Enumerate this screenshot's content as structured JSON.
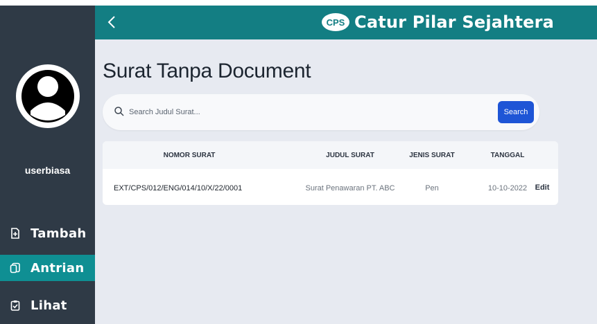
{
  "app": {
    "brand_name": "Catur Pilar Sejahtera",
    "brand_logo_text": "CPS"
  },
  "sidebar": {
    "username": "userbiasa",
    "items": [
      {
        "label": "Tambah",
        "icon": "file-plus-icon",
        "active": false
      },
      {
        "label": "Antrian",
        "icon": "copy-icon",
        "active": true
      },
      {
        "label": "Lihat",
        "icon": "clipboard-check-icon",
        "active": false
      }
    ]
  },
  "page": {
    "title": "Surat Tanpa Document"
  },
  "search": {
    "placeholder": "Search Judul Surat...",
    "value": "",
    "button_label": "Search"
  },
  "table": {
    "columns": [
      "NOMOR SURAT",
      "JUDUL SURAT",
      "JENIS SURAT",
      "TANGGAL"
    ],
    "rows": [
      {
        "nomor_surat": "EXT/CPS/012/ENG/014/10/X/22/0001",
        "judul_surat": "Surat Penawaran PT. ABC",
        "jenis_surat": "Pen",
        "tanggal": "10-10-2022",
        "action_label": "Edit"
      }
    ]
  },
  "colors": {
    "sidebar_bg": "#2f3a46",
    "topbar_bg": "#137e83",
    "active_item_bg": "#0f8f93",
    "content_bg": "#e7eaf1",
    "search_button_bg": "#1e55d6"
  }
}
